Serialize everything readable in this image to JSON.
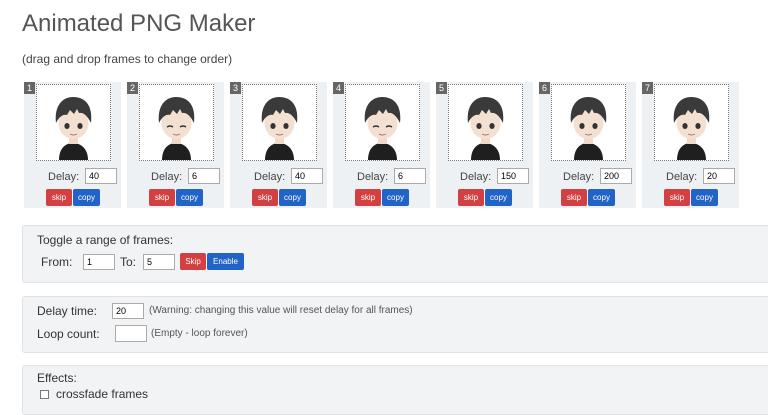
{
  "page": {
    "title": "Animated PNG Maker",
    "subtitle": "(drag and drop frames to change order)"
  },
  "frames": [
    {
      "number": "1",
      "delay_label": "Delay:",
      "delay": "40",
      "skip_label": "skip",
      "copy_label": "copy"
    },
    {
      "number": "2",
      "delay_label": "Delay:",
      "delay": "6",
      "skip_label": "skip",
      "copy_label": "copy"
    },
    {
      "number": "3",
      "delay_label": "Delay:",
      "delay": "40",
      "skip_label": "skip",
      "copy_label": "copy"
    },
    {
      "number": "4",
      "delay_label": "Delay:",
      "delay": "6",
      "skip_label": "skip",
      "copy_label": "copy"
    },
    {
      "number": "5",
      "delay_label": "Delay:",
      "delay": "150",
      "skip_label": "skip",
      "copy_label": "copy"
    },
    {
      "number": "6",
      "delay_label": "Delay:",
      "delay": "200",
      "skip_label": "skip",
      "copy_label": "copy"
    },
    {
      "number": "7",
      "delay_label": "Delay:",
      "delay": "20",
      "skip_label": "skip",
      "copy_label": "copy"
    }
  ],
  "toggle_range": {
    "heading": "Toggle a range of frames:",
    "from_label": "From:",
    "from_value": "1",
    "to_label": "To:",
    "to_value": "5",
    "skip_label": "Skip",
    "enable_label": "Enable"
  },
  "settings": {
    "delay_label": "Delay time:",
    "delay_value": "20",
    "delay_note": "(Warning: changing this value will reset delay for all frames)",
    "loop_label": "Loop count:",
    "loop_value": "",
    "loop_note": "(Empty - loop forever)"
  },
  "effects": {
    "heading": "Effects:",
    "crossfade_label": "crossfade frames",
    "crossfade_checked": false
  },
  "colors": {
    "skip_button": "#d24042",
    "copy_button": "#2163c7",
    "frame_background": "#eef1f4"
  }
}
